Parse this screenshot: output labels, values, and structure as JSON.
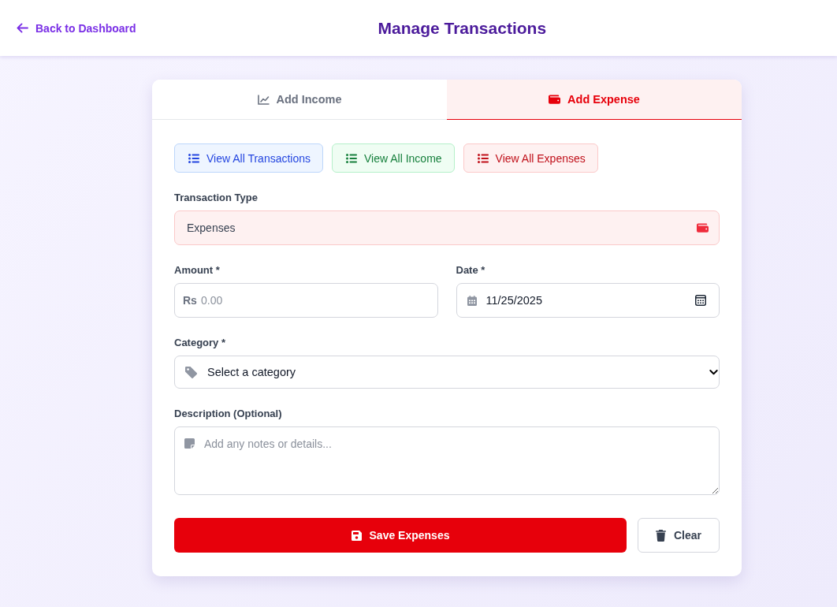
{
  "header": {
    "back_link": "Back to Dashboard",
    "title": "Manage Transactions"
  },
  "tabs": [
    {
      "label": "Add Income",
      "kind": "income",
      "selected": false
    },
    {
      "label": "Add Expense",
      "kind": "expense",
      "selected": true
    }
  ],
  "view_buttons": [
    {
      "label": "View All Transactions",
      "kind": "all"
    },
    {
      "label": "View All Income",
      "kind": "income"
    },
    {
      "label": "View All Expenses",
      "kind": "expense"
    }
  ],
  "form": {
    "transaction_type": {
      "label": "Transaction Type",
      "value": "Expenses",
      "kind": "expense"
    },
    "amount": {
      "label": "Amount *",
      "prefix": "Rs",
      "placeholder": "0.00"
    },
    "date": {
      "label": "Date *",
      "value": "11/25/2025"
    },
    "category": {
      "label": "Category *",
      "value": "Select a category"
    },
    "description": {
      "label": "Description (Optional)",
      "placeholder": "Add any notes or details..."
    }
  },
  "actions": [
    {
      "label": "Save Expenses",
      "kind": "save"
    },
    {
      "label": "Clear",
      "kind": "clear"
    }
  ]
}
